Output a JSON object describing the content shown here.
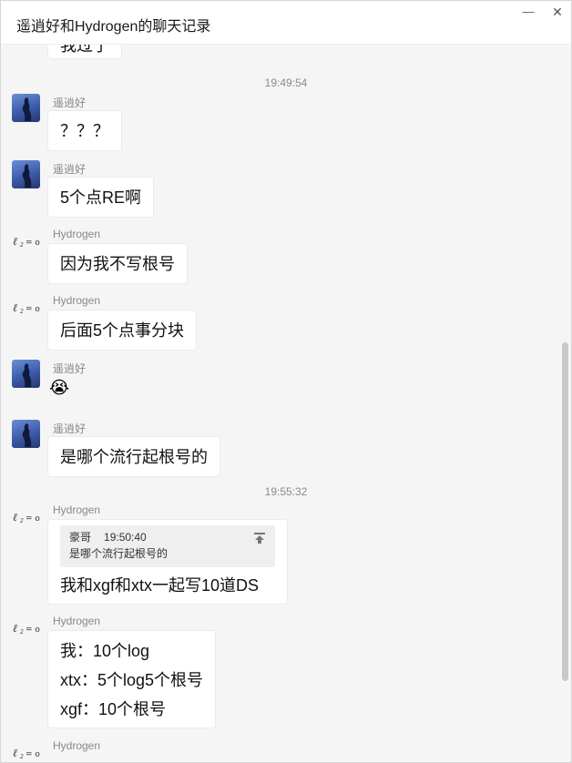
{
  "window": {
    "title": "遥逍好和Hydrogen的聊天记录",
    "minimize_glyph": "—",
    "close_glyph": "✕"
  },
  "chat": {
    "partial_top_text": "我过了",
    "time1": "19:49:54",
    "time2": "19:55:32",
    "messages": [
      {
        "sender": "遥逍好",
        "lines": [
          "？？？"
        ]
      },
      {
        "sender": "遥逍好",
        "lines": [
          "5个点RE啊"
        ]
      },
      {
        "sender": "Hydrogen",
        "lines": [
          "因为我不写根号"
        ]
      },
      {
        "sender": "Hydrogen",
        "lines": [
          "后面5个点事分块"
        ]
      },
      {
        "sender": "遥逍好",
        "emoji": "😭"
      },
      {
        "sender": "遥逍好",
        "lines": [
          "是哪个流行起根号的"
        ]
      },
      {
        "sender": "Hydrogen",
        "quote": {
          "author": "豪哥",
          "time": "19:50:40",
          "text": "是哪个流行起根号的"
        },
        "lines": [
          "我和xgf和xtx一起写10道DS"
        ]
      },
      {
        "sender": "Hydrogen",
        "lines": [
          "我：10个log",
          "xtx：5个log5个根号",
          "xgf：10个根号"
        ]
      },
      {
        "sender": "Hydrogen"
      }
    ]
  },
  "avatar_b_label": "ℓ",
  "colors": {
    "background": "#f5f5f5",
    "bubble": "#ffffff",
    "avatar_a": "#3c5aa8",
    "scrollbar": "#c9c9c9"
  },
  "icons": {
    "minimize": "minimize-icon",
    "close": "close-icon",
    "avatar_a": "avatar-silhouette-icon",
    "avatar_b": "avatar-formula-icon",
    "quote_jump": "jump-to-top-icon"
  }
}
